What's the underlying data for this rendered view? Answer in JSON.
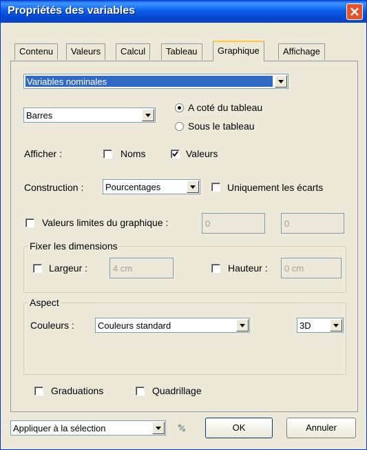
{
  "window": {
    "title": "Propriétés des variables"
  },
  "tabs": [
    "Contenu",
    "Valeurs",
    "Calcul",
    "Tableau",
    "Graphique",
    "Affichage"
  ],
  "variable_type": {
    "selected": "Variables nominales"
  },
  "chart_type": {
    "selected": "Barres"
  },
  "position": {
    "options": [
      "A coté du tableau",
      "Sous le tableau"
    ],
    "selected": "A coté du tableau"
  },
  "display": {
    "label": "Afficher :",
    "noms": {
      "label": "Noms",
      "checked": false
    },
    "valeurs": {
      "label": "Valeurs",
      "checked": true
    }
  },
  "construction": {
    "label": "Construction :",
    "selected": "Pourcentages",
    "gaps_only": {
      "label": "Uniquement les écarts",
      "checked": false
    }
  },
  "limits": {
    "label": "Valeurs limites du graphique :",
    "checked": false,
    "min": "0",
    "max": "0"
  },
  "dimensions": {
    "group_title": "Fixer les dimensions",
    "width": {
      "label": "Largeur :",
      "value": "4 cm",
      "checked": false
    },
    "height": {
      "label": "Hauteur :",
      "value": "0 cm",
      "checked": false
    }
  },
  "aspect": {
    "group_title": "Aspect",
    "colors_label": "Couleurs :",
    "colors_selected": "Couleurs standard",
    "mode_selected": "3D"
  },
  "bottom_options": {
    "graduations": {
      "label": "Graduations",
      "checked": false
    },
    "quadrillage": {
      "label": "Quadrillage",
      "checked": false
    }
  },
  "footer": {
    "apply_selected": "Appliquer à la sélection",
    "ok_label": "OK",
    "cancel_label": "Annuler"
  },
  "colors": {
    "title_bar": "#0548d0",
    "highlight": "#316ac5",
    "dialog_bg": "#ece9d8",
    "close": "#e3532b"
  }
}
